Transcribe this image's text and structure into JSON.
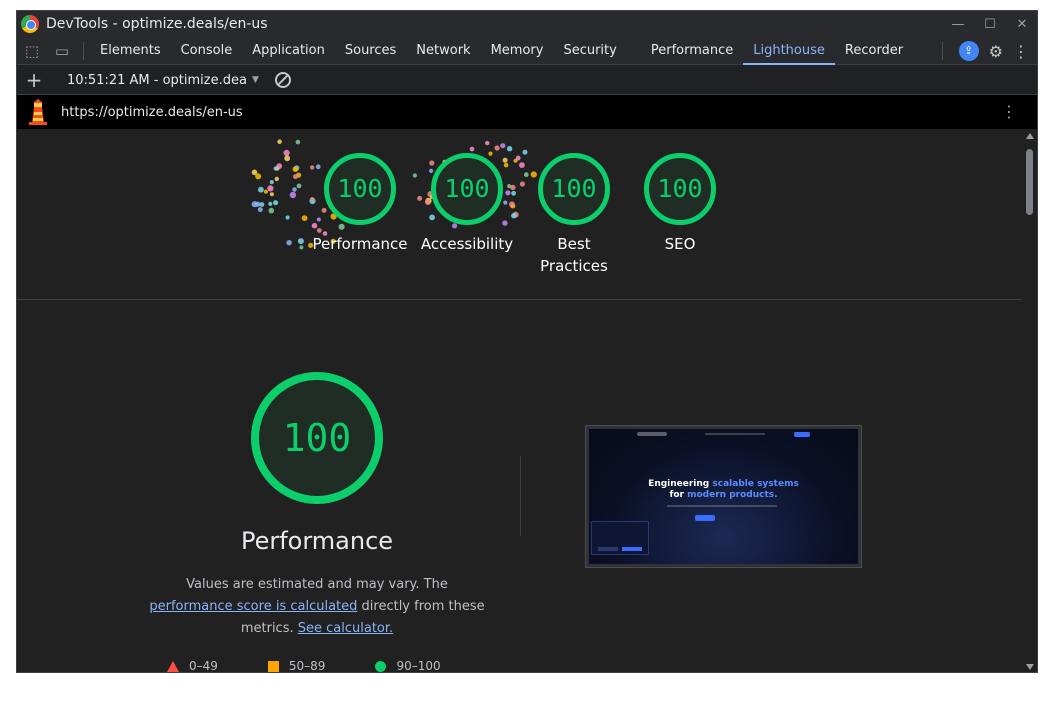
{
  "window": {
    "title": "DevTools - optimize.deals/en-us"
  },
  "tabs": [
    "Elements",
    "Console",
    "Application",
    "Sources",
    "Network",
    "Memory",
    "Security",
    "Performance",
    "Lighthouse",
    "Recorder"
  ],
  "active_tab": "Lighthouse",
  "report": {
    "selector": "10:51:21 AM - optimize.dea"
  },
  "url": "https://optimize.deals/en-us",
  "categories": [
    {
      "label": "Performance",
      "score": "100"
    },
    {
      "label": "Accessibility",
      "score": "100"
    },
    {
      "label": "Best Practices",
      "score": "100"
    },
    {
      "label": "SEO",
      "score": "100"
    }
  ],
  "performance": {
    "score": "100",
    "title": "Performance",
    "desc_pre": "Values are estimated and may vary. The ",
    "desc_link1": "performance score is calculated",
    "desc_mid": " directly from these metrics. ",
    "desc_link2": "See calculator."
  },
  "legend": {
    "fail": "0–49",
    "average": "50–89",
    "pass": "90–100"
  },
  "screenshot": {
    "headline_1": "Engineering ",
    "headline_hl": "scalable systems",
    "headline_2": "for ",
    "headline_hl2": "modern products."
  },
  "colors": {
    "pass": "#0cce6b",
    "average": "#ffa400",
    "fail": "#ff4e42",
    "accent": "#8ab4f8"
  }
}
